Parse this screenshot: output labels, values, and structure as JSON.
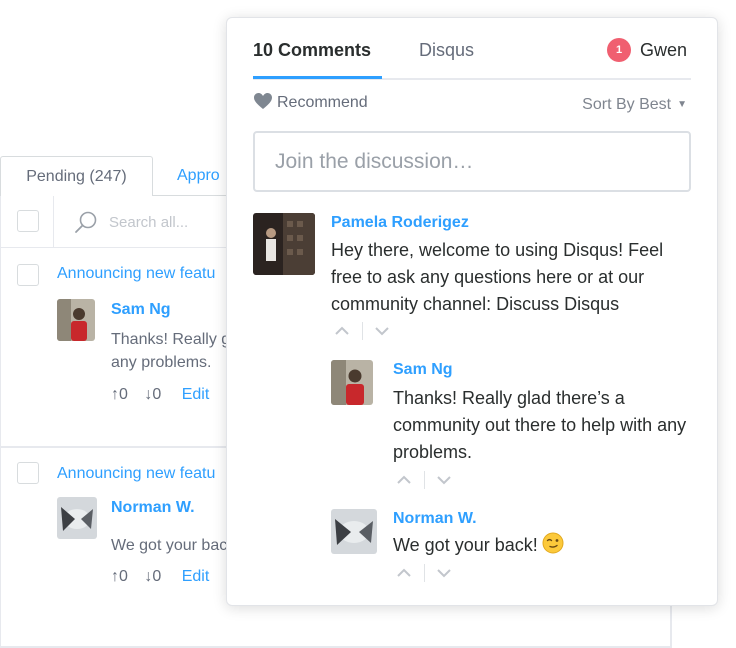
{
  "moderation": {
    "tabs": {
      "pending": "Pending (247)",
      "approved": "Appro"
    },
    "search_placeholder": "Search all...",
    "items": [
      {
        "thread_title": "Announcing new featu",
        "author": "Sam Ng",
        "text": "Thanks! Really g any problems.",
        "upvotes": "0",
        "downvotes": "0",
        "edit_label": "Edit"
      },
      {
        "thread_title": "Announcing new featu",
        "author": "Norman W.",
        "text": "We got your bac",
        "upvotes": "0",
        "downvotes": "0",
        "edit_label": "Edit"
      }
    ]
  },
  "embed": {
    "nav": {
      "comments_tab": "10 Comments",
      "disqus_tab": "Disqus",
      "notification_count": "1",
      "user_name": "Gwen"
    },
    "recommend_label": "Recommend",
    "sort_label": "Sort By Best",
    "join_placeholder": "Join the discussion…",
    "comments": [
      {
        "author": "Pamela Roderigez",
        "text": "Hey there, welcome to using Disqus! Feel free to ask any questions here or at our community channel: Discuss Disqus",
        "replies": [
          {
            "author": "Sam Ng",
            "text": "Thanks! Really glad there’s a community out there to help with any problems."
          },
          {
            "author": "Norman W.",
            "text": "We got your back!"
          }
        ]
      }
    ]
  },
  "colors": {
    "link": "#2e9fff",
    "badge": "#f05f70",
    "text": "#2a2e2e",
    "muted": "#656c7a"
  }
}
